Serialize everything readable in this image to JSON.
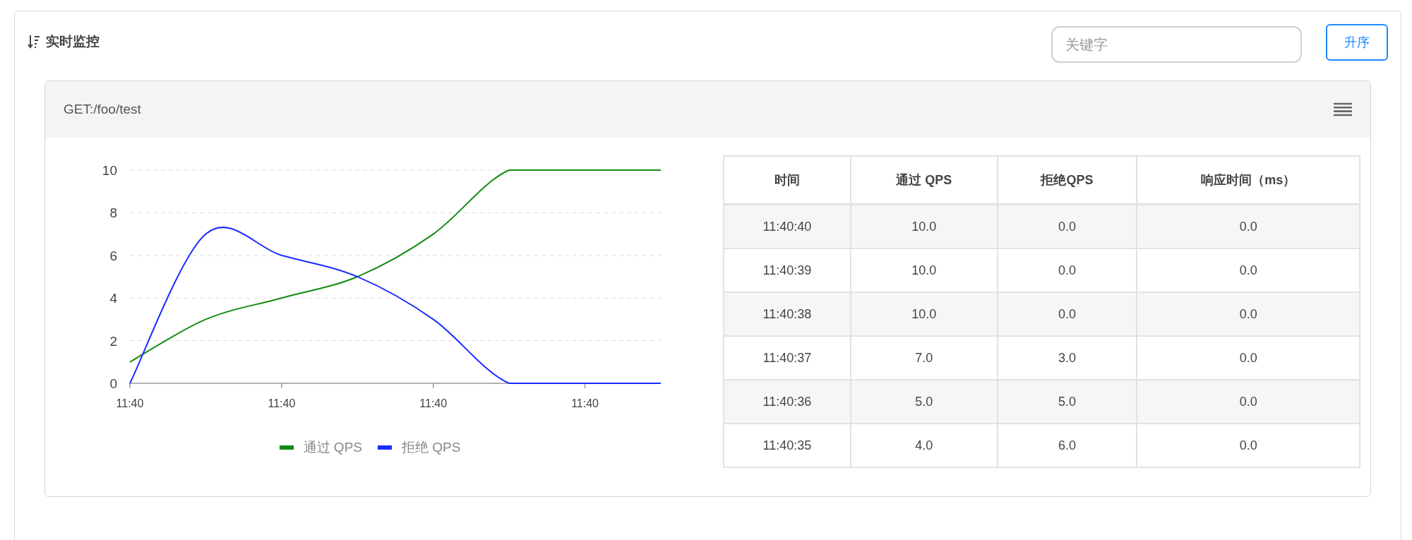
{
  "header": {
    "title": "实时监控",
    "search": {
      "placeholder": "关键字"
    },
    "sort_button": "升序"
  },
  "panel": {
    "title": "GET:/foo/test",
    "x_axis_labels": [
      "11:40",
      "11:40",
      "11:40",
      "11:40"
    ],
    "chart_data": {
      "type": "line",
      "ylim": [
        0,
        10
      ],
      "yticks": [
        0,
        2,
        4,
        6,
        8,
        10
      ],
      "grid": true,
      "legend": true,
      "series": [
        {
          "name": "通过 QPS",
          "color": "#138b13",
          "values": [
            1,
            3,
            4,
            5,
            7,
            10,
            10,
            10
          ]
        },
        {
          "name": "拒绝 QPS",
          "color": "#1a2cff",
          "values": [
            0,
            7,
            6,
            5,
            3,
            0,
            0,
            0
          ]
        }
      ]
    },
    "table": {
      "columns": [
        "时间",
        "通过 QPS",
        "拒绝QPS",
        "响应时间（ms）"
      ],
      "rows": [
        [
          "11:40:40",
          "10.0",
          "0.0",
          "0.0"
        ],
        [
          "11:40:39",
          "10.0",
          "0.0",
          "0.0"
        ],
        [
          "11:40:38",
          "10.0",
          "0.0",
          "0.0"
        ],
        [
          "11:40:37",
          "7.0",
          "3.0",
          "0.0"
        ],
        [
          "11:40:36",
          "5.0",
          "5.0",
          "0.0"
        ],
        [
          "11:40:35",
          "4.0",
          "6.0",
          "0.0"
        ]
      ]
    }
  }
}
